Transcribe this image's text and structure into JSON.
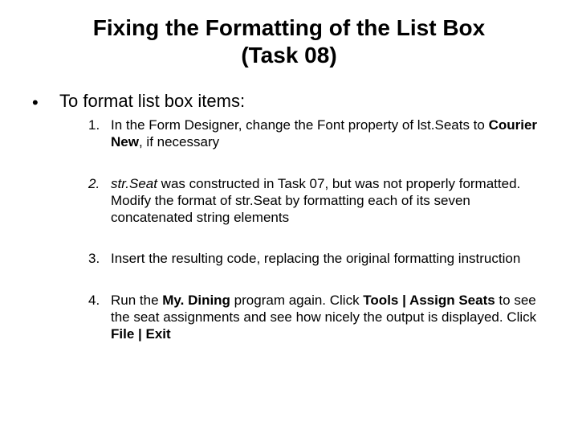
{
  "title_line1": "Fixing the Formatting of the List Box",
  "title_line2": "(Task 08)",
  "lead": "To format list box items:",
  "s1_a": "In the Form Designer, change the Font property of lst.Seats to ",
  "s1_b": "Courier New",
  "s1_c": ", if necessary",
  "s2_a": "str.Seat",
  "s2_b": " was constructed in Task 07, but was not properly formatted. Modify the format of str.Seat by formatting each of its seven concatenated string elements",
  "s3": "Insert the resulting code, replacing the original formatting instruction",
  "s4_a": "Run the ",
  "s4_b": "My. Dining",
  "s4_c": " program again. Click ",
  "s4_d": "Tools | Assign Seats",
  "s4_e": " to see the seat assignments and see how nicely the output is displayed. Click ",
  "s4_f": "File | Exit"
}
